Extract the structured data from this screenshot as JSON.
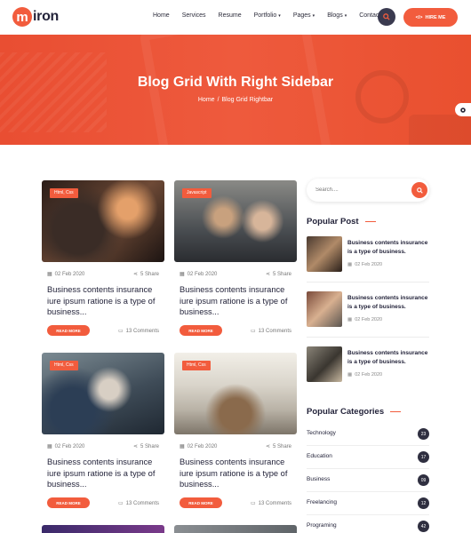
{
  "brand": {
    "logo_letter": "m",
    "logo_text": "iron",
    "accent": "#f25c3d",
    "dark": "#2f2f40"
  },
  "nav": {
    "items": [
      {
        "label": "Home",
        "dropdown": false
      },
      {
        "label": "Services",
        "dropdown": false
      },
      {
        "label": "Resume",
        "dropdown": false
      },
      {
        "label": "Portfolio",
        "dropdown": true
      },
      {
        "label": "Pages",
        "dropdown": true
      },
      {
        "label": "Blogs",
        "dropdown": true
      },
      {
        "label": "Contact",
        "dropdown": false
      }
    ],
    "search_icon": "search-icon",
    "hire_label": "HIRE ME",
    "hire_icon": "code-icon"
  },
  "hero": {
    "title": "Blog Grid With Right Sidebar",
    "breadcrumb_home": "Home",
    "breadcrumb_sep": "/",
    "breadcrumb_current": "Blog Grid Rightbar"
  },
  "posts": [
    {
      "tag": "Html, Css",
      "date": "02 Feb 2020",
      "shares": "5 Share",
      "title": "Business contents insurance iure ipsum ratione is a type of business...",
      "read_more": "READ MORE",
      "comments": "13 Comments"
    },
    {
      "tag": "Javascript",
      "date": "02 Feb 2020",
      "shares": "5 Share",
      "title": "Business contents insurance iure ipsum ratione is a type of business...",
      "read_more": "READ MORE",
      "comments": "13 Comments"
    },
    {
      "tag": "Html, Css",
      "date": "02 Feb 2020",
      "shares": "5 Share",
      "title": "Business contents insurance iure ipsum ratione is a type of business...",
      "read_more": "READ MORE",
      "comments": "13 Comments"
    },
    {
      "tag": "Html, Css",
      "date": "02 Feb 2020",
      "shares": "5 Share",
      "title": "Business contents insurance iure ipsum ratione is a type of business...",
      "read_more": "READ MORE",
      "comments": "13 Comments"
    }
  ],
  "sidebar": {
    "search_placeholder": "Search....",
    "popular_post_heading": "Popular Post",
    "popular_posts": [
      {
        "title": "Business contents insurance is a type of business.",
        "date": "02 Feb 2020"
      },
      {
        "title": "Business contents insurance is a type of business.",
        "date": "02 Feb 2020"
      },
      {
        "title": "Business contents insurance is a type of business.",
        "date": "02 Feb 2020"
      }
    ],
    "categories_heading": "Popular Categories",
    "categories": [
      {
        "label": "Technology",
        "count": "23"
      },
      {
        "label": "Education",
        "count": "17"
      },
      {
        "label": "Business",
        "count": "09"
      },
      {
        "label": "Freelancing",
        "count": "12"
      },
      {
        "label": "Programing",
        "count": "42"
      }
    ]
  }
}
